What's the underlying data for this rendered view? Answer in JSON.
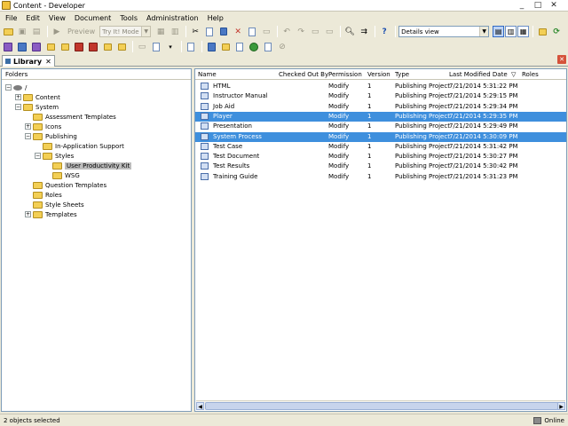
{
  "window": {
    "title": "Content - Developer",
    "minimize": "_",
    "maximize": "□",
    "close": "✕"
  },
  "menu": [
    "File",
    "Edit",
    "View",
    "Document",
    "Tools",
    "Administration",
    "Help"
  ],
  "toolbar": {
    "preview_label": "Preview",
    "mode_value": "Try It! Mode",
    "view_value": "Details view"
  },
  "tab": {
    "label": "Library",
    "close": "✕"
  },
  "folders": {
    "header": "Folders",
    "root_label": "/",
    "items": [
      {
        "label": "Content",
        "expander": "+"
      },
      {
        "label": "System",
        "expander": "−"
      },
      {
        "label": "Assessment Templates",
        "expander": ""
      },
      {
        "label": "Icons",
        "expander": "+"
      },
      {
        "label": "Publishing",
        "expander": "−"
      },
      {
        "label": "In-Application Support",
        "expander": ""
      },
      {
        "label": "Styles",
        "expander": "−"
      },
      {
        "label": "User Productivity Kit",
        "expander": ""
      },
      {
        "label": "WSG",
        "expander": ""
      },
      {
        "label": "Question Templates",
        "expander": ""
      },
      {
        "label": "Roles",
        "expander": ""
      },
      {
        "label": "Style Sheets",
        "expander": ""
      },
      {
        "label": "Templates",
        "expander": "+"
      }
    ]
  },
  "table": {
    "columns": [
      "Name",
      "Checked Out By",
      "Permission",
      "Version",
      "Type",
      "Last Modified Date",
      "Roles"
    ],
    "sort_indicator": "▽",
    "rows": [
      {
        "name": "HTML",
        "checked_out_by": "",
        "permission": "Modify",
        "version": "1",
        "type": "Publishing Project",
        "modified": "7/21/2014 5:31:22 PM",
        "roles": "",
        "selected": false
      },
      {
        "name": "Instructor Manual",
        "checked_out_by": "",
        "permission": "Modify",
        "version": "1",
        "type": "Publishing Project",
        "modified": "7/21/2014 5:29:15 PM",
        "roles": "",
        "selected": false
      },
      {
        "name": "Job Aid",
        "checked_out_by": "",
        "permission": "Modify",
        "version": "1",
        "type": "Publishing Project",
        "modified": "7/21/2014 5:29:34 PM",
        "roles": "",
        "selected": false
      },
      {
        "name": "Player",
        "checked_out_by": "",
        "permission": "Modify",
        "version": "1",
        "type": "Publishing Project",
        "modified": "7/21/2014 5:29:35 PM",
        "roles": "",
        "selected": true
      },
      {
        "name": "Presentation",
        "checked_out_by": "",
        "permission": "Modify",
        "version": "1",
        "type": "Publishing Project",
        "modified": "7/21/2014 5:29:49 PM",
        "roles": "",
        "selected": false
      },
      {
        "name": "System Process",
        "checked_out_by": "",
        "permission": "Modify",
        "version": "1",
        "type": "Publishing Project",
        "modified": "7/21/2014 5:30:09 PM",
        "roles": "",
        "selected": true
      },
      {
        "name": "Test Case",
        "checked_out_by": "",
        "permission": "Modify",
        "version": "1",
        "type": "Publishing Project",
        "modified": "7/21/2014 5:31:42 PM",
        "roles": "",
        "selected": false
      },
      {
        "name": "Test Document",
        "checked_out_by": "",
        "permission": "Modify",
        "version": "1",
        "type": "Publishing Project",
        "modified": "7/21/2014 5:30:27 PM",
        "roles": "",
        "selected": false
      },
      {
        "name": "Test Results",
        "checked_out_by": "",
        "permission": "Modify",
        "version": "1",
        "type": "Publishing Project",
        "modified": "7/21/2014 5:30:42 PM",
        "roles": "",
        "selected": false
      },
      {
        "name": "Training Guide",
        "checked_out_by": "",
        "permission": "Modify",
        "version": "1",
        "type": "Publishing Project",
        "modified": "7/21/2014 5:31:23 PM",
        "roles": "",
        "selected": false
      }
    ]
  },
  "status": {
    "text": "2 objects selected",
    "connection": "Online"
  },
  "colors": {
    "selection": "#3e8fdd",
    "chrome": "#ece9d8",
    "border": "#7f9db9"
  }
}
